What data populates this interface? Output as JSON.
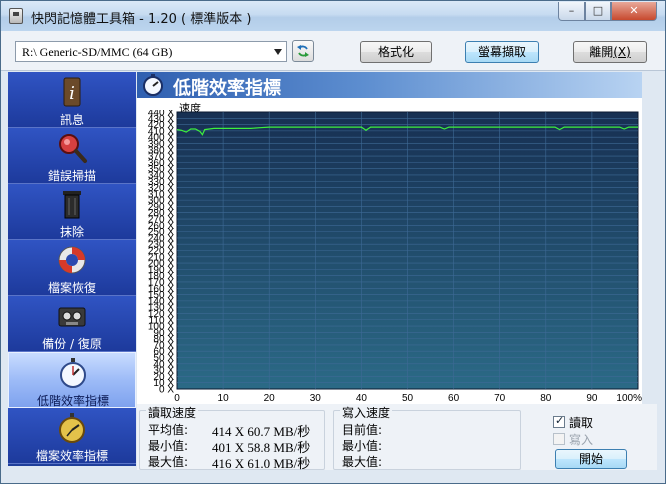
{
  "window": {
    "title": "快閃記憶體工具箱 - 1.20 ( 標準版本 )",
    "controls": {
      "minimize": "–",
      "maximize": "□",
      "close": "✕"
    }
  },
  "toolbar": {
    "drive": "R:\\ Generic-SD/MMC (64 GB)",
    "refresh_icon": "refresh-icon",
    "format_label": "格式化",
    "capture_label": "螢幕擷取",
    "exit_label_main": "離開",
    "exit_label_hotkey": "(X)"
  },
  "sidebar": {
    "items": [
      {
        "label": "訊息",
        "icon": "info-icon"
      },
      {
        "label": "錯誤掃描",
        "icon": "magnifier-icon"
      },
      {
        "label": "抹除",
        "icon": "trash-icon"
      },
      {
        "label": "檔案恢復",
        "icon": "lifebuoy-icon"
      },
      {
        "label": "備份 / 復原",
        "icon": "tape-icon"
      },
      {
        "label": "低階效率指標",
        "icon": "stopwatch-icon",
        "active": true
      },
      {
        "label": "檔案效率指標",
        "icon": "stopwatch-gold-icon"
      }
    ]
  },
  "panel": {
    "title": "低階效率指標",
    "y_axis_label": "速度"
  },
  "chart_data": {
    "type": "line",
    "ylabel": "速度",
    "xlabel": "",
    "y_ticks": [
      "0 X",
      "10 X",
      "20 X",
      "30 X",
      "40 X",
      "50 X",
      "60 X",
      "70 X",
      "80 X",
      "90 X",
      "100 X",
      "110 X",
      "120 X",
      "130 X",
      "140 X",
      "150 X",
      "160 X",
      "170 X",
      "180 X",
      "190 X",
      "200 X",
      "210 X",
      "220 X",
      "230 X",
      "240 X",
      "250 X",
      "260 X",
      "270 X",
      "280 X",
      "290 X",
      "300 X",
      "310 X",
      "320 X",
      "330 X",
      "340 X",
      "350 X",
      "360 X",
      "370 X",
      "380 X",
      "390 X",
      "400 X",
      "410 X",
      "420 X",
      "430 X",
      "440 X"
    ],
    "x_ticks": [
      "0",
      "10",
      "20",
      "30",
      "40",
      "50",
      "60",
      "70",
      "80",
      "90",
      "100%"
    ],
    "xlim": [
      0,
      100
    ],
    "ylim": [
      0,
      440
    ],
    "grid": true,
    "colors": {
      "background": "#1c3c66",
      "grid": "#3e6a96",
      "line": "#3df03d"
    },
    "series": [
      {
        "values": [
          [
            0,
            412
          ],
          [
            1,
            411
          ],
          [
            2,
            408
          ],
          [
            3,
            413
          ],
          [
            4,
            413
          ],
          [
            5,
            409
          ],
          [
            5.5,
            404
          ],
          [
            6,
            412
          ],
          [
            7,
            413
          ],
          [
            8,
            414
          ],
          [
            10,
            414
          ],
          [
            12,
            414
          ],
          [
            14,
            414
          ],
          [
            16,
            414
          ],
          [
            18,
            415
          ],
          [
            20,
            416
          ],
          [
            22,
            416
          ],
          [
            25,
            416
          ],
          [
            28,
            416
          ],
          [
            30,
            416
          ],
          [
            32,
            416
          ],
          [
            35,
            416
          ],
          [
            38,
            416
          ],
          [
            40,
            416
          ],
          [
            41,
            411
          ],
          [
            42,
            416
          ],
          [
            45,
            416
          ],
          [
            48,
            416
          ],
          [
            50,
            416
          ],
          [
            52,
            416
          ],
          [
            55,
            416
          ],
          [
            57,
            416
          ],
          [
            58,
            413
          ],
          [
            59,
            416
          ],
          [
            62,
            416
          ],
          [
            65,
            416
          ],
          [
            68,
            416
          ],
          [
            70,
            416
          ],
          [
            72,
            416
          ],
          [
            75,
            416
          ],
          [
            78,
            416
          ],
          [
            80,
            416
          ],
          [
            82,
            416
          ],
          [
            83,
            412
          ],
          [
            84,
            416
          ],
          [
            86,
            416
          ],
          [
            88,
            416
          ],
          [
            90,
            416
          ],
          [
            92,
            416
          ],
          [
            94,
            416
          ],
          [
            96,
            416
          ],
          [
            97,
            413
          ],
          [
            98,
            416
          ],
          [
            100,
            416
          ]
        ]
      }
    ]
  },
  "stats": {
    "read_title": "讀取速度",
    "write_title": "寫入速度",
    "avg_label": "平均值:",
    "min_label": "最小值:",
    "max_label": "最大值:",
    "cur_label": "目前值:",
    "read_avg": "414  X   60.7 MB/秒",
    "read_min": "401  X   58.8 MB/秒",
    "read_max": "416  X   61.0 MB/秒",
    "write_cur": "",
    "write_min": "",
    "write_max": ""
  },
  "controls": {
    "read_checkbox": "讀取",
    "read_checked": true,
    "write_checkbox": "寫入",
    "write_checked": false,
    "start_label": "開始"
  }
}
